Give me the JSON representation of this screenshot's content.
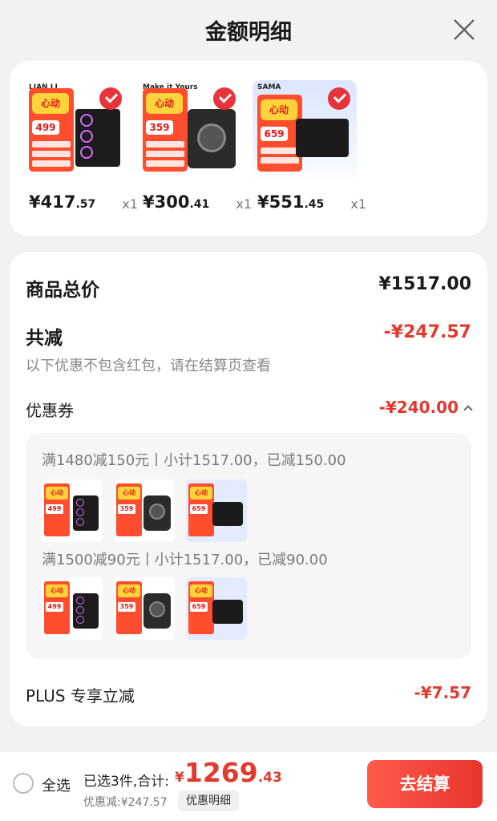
{
  "header": {
    "title": "金额明细"
  },
  "colors": {
    "accent": "#e03a2f",
    "check": "#e8333b",
    "checkout": "#e8352d"
  },
  "products": [
    {
      "brand": "LIAN LI",
      "poster_hot": "心动",
      "poster_price": "499",
      "price_int": "¥417",
      "price_dec": ".57",
      "qty": "x1",
      "icon": "pc-case-image"
    },
    {
      "brand": "Make it Yours",
      "poster_hot": "心动",
      "poster_price": "359",
      "price_int": "¥300",
      "price_dec": ".41",
      "qty": "x1",
      "icon": "cpu-cooler-image"
    },
    {
      "brand": "SAMA",
      "poster_hot": "心动",
      "poster_price": "659",
      "price_int": "¥551",
      "price_dec": ".45",
      "qty": "x1",
      "icon": "power-supply-image"
    }
  ],
  "summary": {
    "goods_total_label": "商品总价",
    "goods_total_value": "¥1517.00",
    "reduce_label": "共减",
    "reduce_value": "-¥247.57",
    "reduce_note": "以下优惠不包含红包，请在结算页查看",
    "coupon_label": "优惠券",
    "coupon_value": "-¥240.00"
  },
  "coupon_groups": [
    {
      "header": "满1480减150元丨小计1517.00，已减150.00"
    },
    {
      "header": "满1500减90元丨小计1517.00，已减90.00"
    }
  ],
  "plus": {
    "label": "PLUS 专享立减",
    "value": "-¥7.57"
  },
  "footer": {
    "select_all": "全选",
    "selected_text": "已选3件,合计:",
    "total_yen": "¥",
    "total_int": "1269",
    "total_dec": ".43",
    "discount_text": "优惠减:¥247.57",
    "detail_button": "优惠明细",
    "checkout_button": "去结算"
  }
}
